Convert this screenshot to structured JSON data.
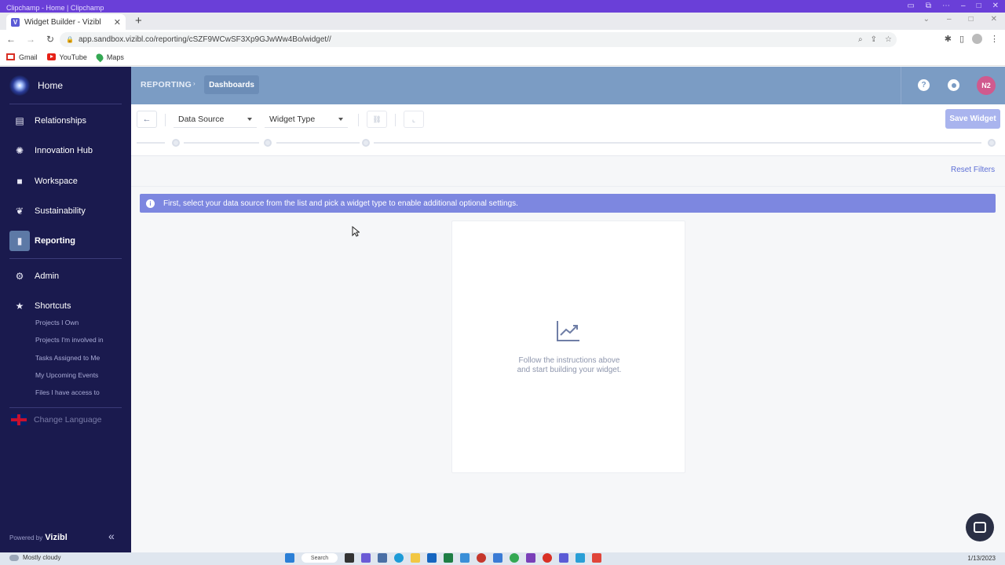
{
  "window": {
    "os_title": "Clipchamp - Home | Clipchamp"
  },
  "browser": {
    "tab_title": "Widget Builder - Vizibl",
    "tab_favicon_letter": "V",
    "url": "app.sandbox.vizibl.co/reporting/cSZF9WCwSF3Xp9GJwWw4Bo/widget//",
    "bookmarks": [
      {
        "label": "Gmail",
        "icon": "gmail-icon"
      },
      {
        "label": "YouTube",
        "icon": "youtube-icon"
      },
      {
        "label": "Maps",
        "icon": "maps-icon"
      }
    ]
  },
  "sidebar": {
    "home_label": "Home",
    "items": [
      {
        "label": "Relationships",
        "icon": "book-icon"
      },
      {
        "label": "Innovation Hub",
        "icon": "lightbulb-icon"
      },
      {
        "label": "Workspace",
        "icon": "folder-icon"
      },
      {
        "label": "Sustainability",
        "icon": "leaf-icon"
      },
      {
        "label": "Reporting",
        "icon": "bar-chart-icon",
        "active": true
      },
      {
        "label": "Admin",
        "icon": "gear-icon"
      },
      {
        "label": "Shortcuts",
        "icon": "star-icon"
      }
    ],
    "shortcuts": [
      "Projects I Own",
      "Projects I'm involved in",
      "Tasks Assigned to Me",
      "My Upcoming Events",
      "Files I have access to"
    ],
    "language_label": "Change Language",
    "powered_by": "Powered by",
    "brand": "Vizibl"
  },
  "header": {
    "breadcrumb_root": "REPORTING",
    "breadcrumb_current": "Dashboards",
    "help_label": "?",
    "user_initials": "N2"
  },
  "toolbar": {
    "back_label": "←",
    "data_source_label": "Data Source",
    "widget_type_label": "Widget Type",
    "save_label": "Save Widget"
  },
  "content": {
    "reset_filters_label": "Reset Filters",
    "info_icon_label": "i",
    "info_message": "First, select your data source from the list and pick a widget type to enable additional optional settings.",
    "placeholder_line1": "Follow the instructions above",
    "placeholder_line2": "and start building your widget."
  },
  "taskbar": {
    "weather": "Mostly cloudy",
    "search_label": "Search",
    "date": "1/13/2023"
  },
  "colors": {
    "sidebar_bg": "#1a1a4e",
    "header_bg": "#7b9cc4",
    "info_bar": "#7d87e0",
    "save_button": "#a9b4ee",
    "accent_link": "#5d6fd6"
  }
}
